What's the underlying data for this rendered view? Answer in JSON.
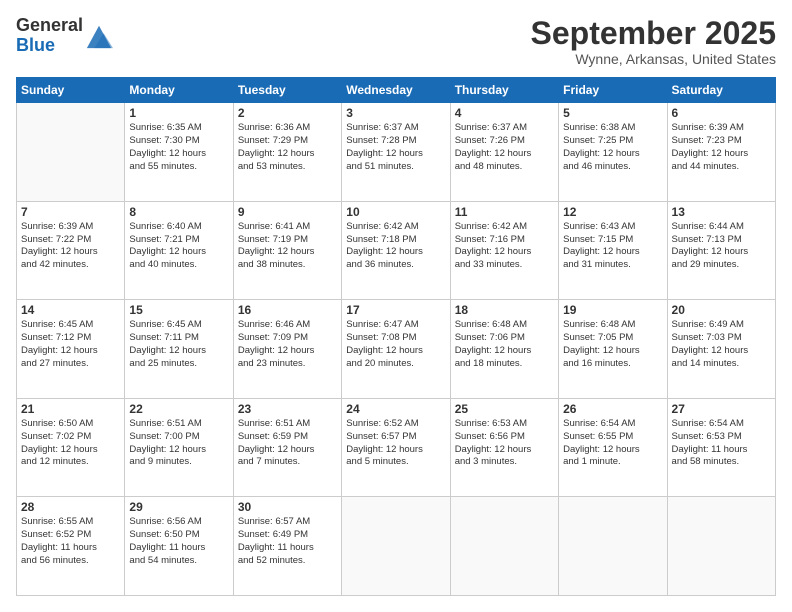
{
  "header": {
    "logo_line1": "General",
    "logo_line2": "Blue",
    "month": "September 2025",
    "location": "Wynne, Arkansas, United States"
  },
  "weekdays": [
    "Sunday",
    "Monday",
    "Tuesday",
    "Wednesday",
    "Thursday",
    "Friday",
    "Saturday"
  ],
  "weeks": [
    [
      {
        "day": "",
        "text": ""
      },
      {
        "day": "1",
        "text": "Sunrise: 6:35 AM\nSunset: 7:30 PM\nDaylight: 12 hours\nand 55 minutes."
      },
      {
        "day": "2",
        "text": "Sunrise: 6:36 AM\nSunset: 7:29 PM\nDaylight: 12 hours\nand 53 minutes."
      },
      {
        "day": "3",
        "text": "Sunrise: 6:37 AM\nSunset: 7:28 PM\nDaylight: 12 hours\nand 51 minutes."
      },
      {
        "day": "4",
        "text": "Sunrise: 6:37 AM\nSunset: 7:26 PM\nDaylight: 12 hours\nand 48 minutes."
      },
      {
        "day": "5",
        "text": "Sunrise: 6:38 AM\nSunset: 7:25 PM\nDaylight: 12 hours\nand 46 minutes."
      },
      {
        "day": "6",
        "text": "Sunrise: 6:39 AM\nSunset: 7:23 PM\nDaylight: 12 hours\nand 44 minutes."
      }
    ],
    [
      {
        "day": "7",
        "text": "Sunrise: 6:39 AM\nSunset: 7:22 PM\nDaylight: 12 hours\nand 42 minutes."
      },
      {
        "day": "8",
        "text": "Sunrise: 6:40 AM\nSunset: 7:21 PM\nDaylight: 12 hours\nand 40 minutes."
      },
      {
        "day": "9",
        "text": "Sunrise: 6:41 AM\nSunset: 7:19 PM\nDaylight: 12 hours\nand 38 minutes."
      },
      {
        "day": "10",
        "text": "Sunrise: 6:42 AM\nSunset: 7:18 PM\nDaylight: 12 hours\nand 36 minutes."
      },
      {
        "day": "11",
        "text": "Sunrise: 6:42 AM\nSunset: 7:16 PM\nDaylight: 12 hours\nand 33 minutes."
      },
      {
        "day": "12",
        "text": "Sunrise: 6:43 AM\nSunset: 7:15 PM\nDaylight: 12 hours\nand 31 minutes."
      },
      {
        "day": "13",
        "text": "Sunrise: 6:44 AM\nSunset: 7:13 PM\nDaylight: 12 hours\nand 29 minutes."
      }
    ],
    [
      {
        "day": "14",
        "text": "Sunrise: 6:45 AM\nSunset: 7:12 PM\nDaylight: 12 hours\nand 27 minutes."
      },
      {
        "day": "15",
        "text": "Sunrise: 6:45 AM\nSunset: 7:11 PM\nDaylight: 12 hours\nand 25 minutes."
      },
      {
        "day": "16",
        "text": "Sunrise: 6:46 AM\nSunset: 7:09 PM\nDaylight: 12 hours\nand 23 minutes."
      },
      {
        "day": "17",
        "text": "Sunrise: 6:47 AM\nSunset: 7:08 PM\nDaylight: 12 hours\nand 20 minutes."
      },
      {
        "day": "18",
        "text": "Sunrise: 6:48 AM\nSunset: 7:06 PM\nDaylight: 12 hours\nand 18 minutes."
      },
      {
        "day": "19",
        "text": "Sunrise: 6:48 AM\nSunset: 7:05 PM\nDaylight: 12 hours\nand 16 minutes."
      },
      {
        "day": "20",
        "text": "Sunrise: 6:49 AM\nSunset: 7:03 PM\nDaylight: 12 hours\nand 14 minutes."
      }
    ],
    [
      {
        "day": "21",
        "text": "Sunrise: 6:50 AM\nSunset: 7:02 PM\nDaylight: 12 hours\nand 12 minutes."
      },
      {
        "day": "22",
        "text": "Sunrise: 6:51 AM\nSunset: 7:00 PM\nDaylight: 12 hours\nand 9 minutes."
      },
      {
        "day": "23",
        "text": "Sunrise: 6:51 AM\nSunset: 6:59 PM\nDaylight: 12 hours\nand 7 minutes."
      },
      {
        "day": "24",
        "text": "Sunrise: 6:52 AM\nSunset: 6:57 PM\nDaylight: 12 hours\nand 5 minutes."
      },
      {
        "day": "25",
        "text": "Sunrise: 6:53 AM\nSunset: 6:56 PM\nDaylight: 12 hours\nand 3 minutes."
      },
      {
        "day": "26",
        "text": "Sunrise: 6:54 AM\nSunset: 6:55 PM\nDaylight: 12 hours\nand 1 minute."
      },
      {
        "day": "27",
        "text": "Sunrise: 6:54 AM\nSunset: 6:53 PM\nDaylight: 11 hours\nand 58 minutes."
      }
    ],
    [
      {
        "day": "28",
        "text": "Sunrise: 6:55 AM\nSunset: 6:52 PM\nDaylight: 11 hours\nand 56 minutes."
      },
      {
        "day": "29",
        "text": "Sunrise: 6:56 AM\nSunset: 6:50 PM\nDaylight: 11 hours\nand 54 minutes."
      },
      {
        "day": "30",
        "text": "Sunrise: 6:57 AM\nSunset: 6:49 PM\nDaylight: 11 hours\nand 52 minutes."
      },
      {
        "day": "",
        "text": ""
      },
      {
        "day": "",
        "text": ""
      },
      {
        "day": "",
        "text": ""
      },
      {
        "day": "",
        "text": ""
      }
    ]
  ]
}
